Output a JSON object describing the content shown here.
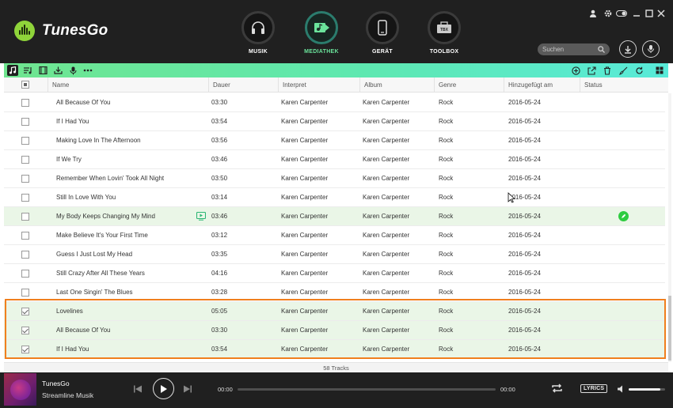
{
  "app": {
    "name": "TunesGo"
  },
  "nav": [
    {
      "label": "MUSIK",
      "icon": "headphones-icon",
      "active": false
    },
    {
      "label": "MEDIATHEK",
      "icon": "library-music-icon",
      "active": true
    },
    {
      "label": "GERÄT",
      "icon": "phone-icon",
      "active": false
    },
    {
      "label": "TOOLBOX",
      "icon": "toolbox-icon",
      "active": false
    }
  ],
  "toolbox_badge": "TBX",
  "search": {
    "placeholder": "Suchen"
  },
  "toolbar": {
    "left_icons": [
      "music-note-icon",
      "playlist-icon",
      "video-icon",
      "download-icon",
      "microphone-icon",
      "more-icon"
    ],
    "right_icons": [
      "add-icon",
      "export-icon",
      "delete-icon",
      "clean-icon",
      "refresh-icon",
      "grid-view-icon"
    ]
  },
  "table": {
    "columns": [
      "Name",
      "Dauer",
      "Interpret",
      "Album",
      "Genre",
      "Hinzugefügt am",
      "Status"
    ],
    "rows": [
      {
        "name": "All Because Of You",
        "duration": "03:30",
        "artist": "Karen Carpenter",
        "album": "Karen Carpenter",
        "genre": "Rock",
        "added": "2016-05-24",
        "checked": false
      },
      {
        "name": "If I Had You",
        "duration": "03:54",
        "artist": "Karen Carpenter",
        "album": "Karen Carpenter",
        "genre": "Rock",
        "added": "2016-05-24",
        "checked": false
      },
      {
        "name": "Making Love In The Afternoon",
        "duration": "03:56",
        "artist": "Karen Carpenter",
        "album": "Karen Carpenter",
        "genre": "Rock",
        "added": "2016-05-24",
        "checked": false
      },
      {
        "name": "If We Try",
        "duration": "03:46",
        "artist": "Karen Carpenter",
        "album": "Karen Carpenter",
        "genre": "Rock",
        "added": "2016-05-24",
        "checked": false
      },
      {
        "name": "Remember When Lovin' Took All Night",
        "duration": "03:50",
        "artist": "Karen Carpenter",
        "album": "Karen Carpenter",
        "genre": "Rock",
        "added": "2016-05-24",
        "checked": false
      },
      {
        "name": "Still In Love With You",
        "duration": "03:14",
        "artist": "Karen Carpenter",
        "album": "Karen Carpenter",
        "genre": "Rock",
        "added": "2016-05-24",
        "checked": false
      },
      {
        "name": "My Body Keeps Changing My Mind",
        "duration": "03:46",
        "artist": "Karen Carpenter",
        "album": "Karen Carpenter",
        "genre": "Rock",
        "added": "2016-05-24",
        "checked": false,
        "hover": true
      },
      {
        "name": "Make Believe It's Your First Time",
        "duration": "03:12",
        "artist": "Karen Carpenter",
        "album": "Karen Carpenter",
        "genre": "Rock",
        "added": "2016-05-24",
        "checked": false
      },
      {
        "name": "Guess I Just Lost My Head",
        "duration": "03:35",
        "artist": "Karen Carpenter",
        "album": "Karen Carpenter",
        "genre": "Rock",
        "added": "2016-05-24",
        "checked": false
      },
      {
        "name": "Still Crazy After All These Years",
        "duration": "04:16",
        "artist": "Karen Carpenter",
        "album": "Karen Carpenter",
        "genre": "Rock",
        "added": "2016-05-24",
        "checked": false
      },
      {
        "name": "Last One Singin' The Blues",
        "duration": "03:28",
        "artist": "Karen Carpenter",
        "album": "Karen Carpenter",
        "genre": "Rock",
        "added": "2016-05-24",
        "checked": false
      },
      {
        "name": "Lovelines",
        "duration": "05:05",
        "artist": "Karen Carpenter",
        "album": "Karen Carpenter",
        "genre": "Rock",
        "added": "2016-05-24",
        "checked": true
      },
      {
        "name": "All Because Of You",
        "duration": "03:30",
        "artist": "Karen Carpenter",
        "album": "Karen Carpenter",
        "genre": "Rock",
        "added": "2016-05-24",
        "checked": true
      },
      {
        "name": "If I Had You",
        "duration": "03:54",
        "artist": "Karen Carpenter",
        "album": "Karen Carpenter",
        "genre": "Rock",
        "added": "2016-05-24",
        "checked": true
      }
    ],
    "footer": "58 Tracks"
  },
  "player": {
    "title": "TunesGo",
    "subtitle": "Streamline Musik",
    "time_current": "00:00",
    "time_total": "00:00",
    "lyrics_label": "LYRICS",
    "volume": 0.87
  },
  "colors": {
    "accent": "#6fe58f",
    "selection": "#f07f1e",
    "highlight": "#eaf6e7",
    "status_green": "#2ecc40"
  }
}
